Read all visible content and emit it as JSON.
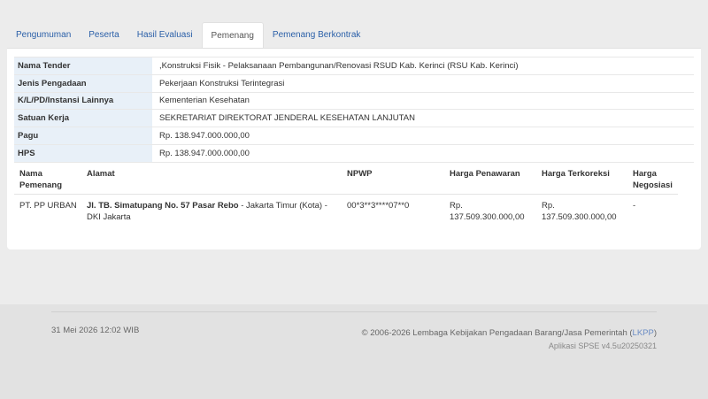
{
  "tabs": [
    {
      "label": "Pengumuman",
      "active": false
    },
    {
      "label": "Peserta",
      "active": false
    },
    {
      "label": "Hasil Evaluasi",
      "active": false
    },
    {
      "label": "Pemenang",
      "active": true
    },
    {
      "label": "Pemenang Berkontrak",
      "active": false
    }
  ],
  "info": [
    {
      "key": "Nama Tender",
      "value": ",Konstruksi Fisik - Pelaksanaan Pembangunan/Renovasi RSUD Kab. Kerinci (RSU Kab. Kerinci)"
    },
    {
      "key": "Jenis Pengadaan",
      "value": "Pekerjaan Konstruksi Terintegrasi"
    },
    {
      "key": "K/L/PD/Instansi Lainnya",
      "value": "Kementerian Kesehatan"
    },
    {
      "key": "Satuan Kerja",
      "value": "SEKRETARIAT DIREKTORAT JENDERAL KESEHATAN LANJUTAN"
    },
    {
      "key": "Pagu",
      "value": "Rp. 138.947.000.000,00"
    },
    {
      "key": "HPS",
      "value": "Rp. 138.947.000.000,00"
    }
  ],
  "winner_table": {
    "headers": {
      "nama_line1": "Nama",
      "nama_line2": "Pemenang",
      "alamat": "Alamat",
      "npwp": "NPWP",
      "penawaran": "Harga Penawaran",
      "terkoreksi": "Harga Terkoreksi",
      "negosiasi_line1": "Harga",
      "negosiasi_line2": "Negosiasi"
    },
    "rows": [
      {
        "nama": "PT. PP URBAN",
        "alamat_bold": "Jl. TB. Simatupang No. 57 Pasar Rebo",
        "alamat_rest": " - Jakarta Timur (Kota) - DKI Jakarta",
        "npwp": "00*3**3****07**0",
        "penawaran_line1": "Rp.",
        "penawaran_line2": "137.509.300.000,00",
        "terkoreksi_line1": "Rp.",
        "terkoreksi_line2": "137.509.300.000,00",
        "negosiasi": "-"
      }
    ]
  },
  "footer": {
    "datetime": "31 Mei 2026 12:02 WIB",
    "copyright_prefix": "© 2006-2026 Lembaga Kebijakan Pengadaan Barang/Jasa Pemerintah (",
    "copyright_link": "LKPP",
    "copyright_suffix": ")",
    "version": "Aplikasi SPSE v4.5u20250321"
  },
  "colors": {
    "link": "#2a5fa8",
    "key_bg": "#e8f0f8",
    "page_bg": "#ececec"
  }
}
